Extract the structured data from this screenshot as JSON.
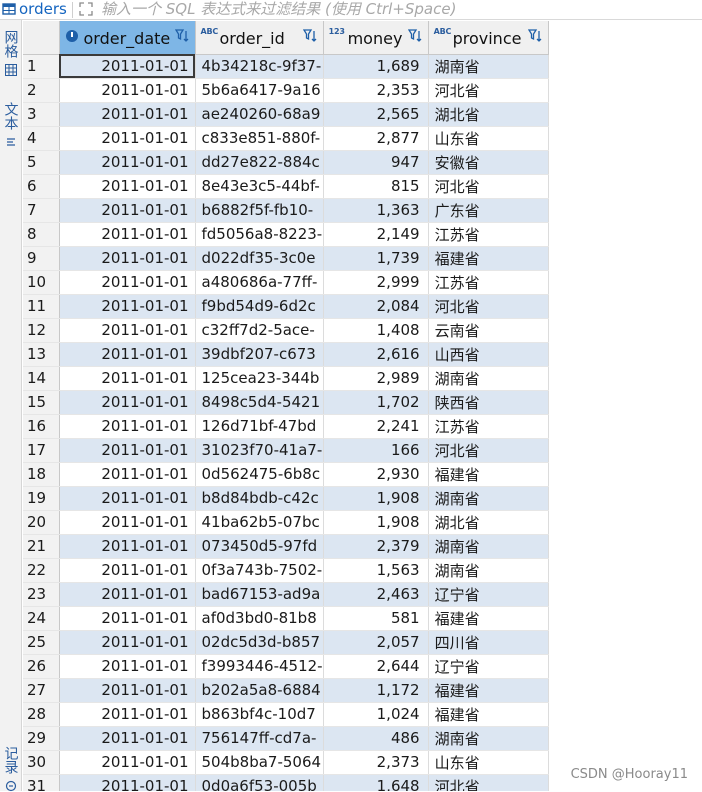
{
  "topbar": {
    "title": "orders",
    "filter_placeholder": "输入一个 SQL 表达式来过滤结果 (使用 Ctrl+Space)"
  },
  "side_tabs": {
    "grid": "网格",
    "text": "文本",
    "record": "记录"
  },
  "columns": [
    {
      "label": "order_date",
      "type_badge": "",
      "icon": "clock-icon"
    },
    {
      "label": "order_id",
      "type_badge": "ABC"
    },
    {
      "label": "money",
      "type_badge": "123"
    },
    {
      "label": "province",
      "type_badge": "ABC"
    }
  ],
  "rows": [
    [
      "2011-01-01",
      "4b34218c-9f37-",
      "1,689",
      "湖南省"
    ],
    [
      "2011-01-01",
      "5b6a6417-9a16",
      "2,353",
      "河北省"
    ],
    [
      "2011-01-01",
      "ae240260-68a9",
      "2,565",
      "湖北省"
    ],
    [
      "2011-01-01",
      "c833e851-880f-",
      "2,877",
      "山东省"
    ],
    [
      "2011-01-01",
      "dd27e822-884c",
      "947",
      "安徽省"
    ],
    [
      "2011-01-01",
      "8e43e3c5-44bf-",
      "815",
      "河北省"
    ],
    [
      "2011-01-01",
      "b6882f5f-fb10-",
      "1,363",
      "广东省"
    ],
    [
      "2011-01-01",
      "fd5056a8-8223-",
      "2,149",
      "江苏省"
    ],
    [
      "2011-01-01",
      "d022df35-3c0e",
      "1,739",
      "福建省"
    ],
    [
      "2011-01-01",
      "a480686a-77ff-",
      "2,999",
      "江苏省"
    ],
    [
      "2011-01-01",
      "f9bd54d9-6d2c",
      "2,084",
      "河北省"
    ],
    [
      "2011-01-01",
      "c32ff7d2-5ace-",
      "1,408",
      "云南省"
    ],
    [
      "2011-01-01",
      "39dbf207-c673",
      "2,616",
      "山西省"
    ],
    [
      "2011-01-01",
      "125cea23-344b",
      "2,989",
      "湖南省"
    ],
    [
      "2011-01-01",
      "8498c5d4-5421",
      "1,702",
      "陕西省"
    ],
    [
      "2011-01-01",
      "126d71bf-47bd",
      "2,241",
      "江苏省"
    ],
    [
      "2011-01-01",
      "31023f70-41a7-",
      "166",
      "河北省"
    ],
    [
      "2011-01-01",
      "0d562475-6b8c",
      "2,930",
      "福建省"
    ],
    [
      "2011-01-01",
      "b8d84bdb-c42c",
      "1,908",
      "湖南省"
    ],
    [
      "2011-01-01",
      "41ba62b5-07bc",
      "1,908",
      "湖北省"
    ],
    [
      "2011-01-01",
      "073450d5-97fd",
      "2,379",
      "湖南省"
    ],
    [
      "2011-01-01",
      "0f3a743b-7502-",
      "1,563",
      "湖南省"
    ],
    [
      "2011-01-01",
      "bad67153-ad9a",
      "2,463",
      "辽宁省"
    ],
    [
      "2011-01-01",
      "af0d3bd0-81b8",
      "581",
      "福建省"
    ],
    [
      "2011-01-01",
      "02dc5d3d-b857",
      "2,057",
      "四川省"
    ],
    [
      "2011-01-01",
      "f3993446-4512-",
      "2,644",
      "辽宁省"
    ],
    [
      "2011-01-01",
      "b202a5a8-6884",
      "1,172",
      "福建省"
    ],
    [
      "2011-01-01",
      "b863bf4c-10d7",
      "1,024",
      "福建省"
    ],
    [
      "2011-01-01",
      "756147ff-cd7a-",
      "486",
      "湖南省"
    ],
    [
      "2011-01-01",
      "504b8ba7-5064",
      "2,373",
      "山东省"
    ],
    [
      "2011-01-01",
      "0d0a6f53-005b",
      "1,648",
      "河北省"
    ]
  ],
  "watermark": "CSDN @Hooray11",
  "colors": {
    "accent": "#1565c0",
    "header_sorted": "#7eb6e6",
    "row_alt": "#dce6f2"
  }
}
